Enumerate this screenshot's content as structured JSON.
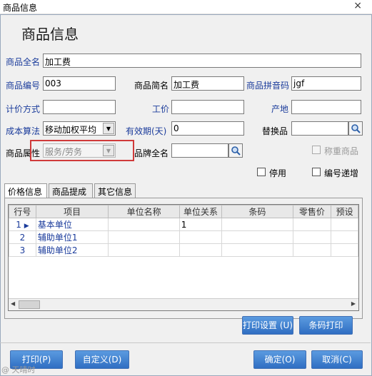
{
  "window": {
    "title": "商品信息",
    "close_glyph": "×"
  },
  "header": {
    "title": "商品信息"
  },
  "form": {
    "full_name": {
      "label": "商品全名",
      "value": "加工费"
    },
    "code": {
      "label": "商品编号",
      "value": "003"
    },
    "short_name": {
      "label": "商品简名",
      "value": "加工费"
    },
    "pinyin": {
      "label": "商品拼音码",
      "value": "jgf"
    },
    "pricing_method": {
      "label": "计价方式",
      "value": ""
    },
    "spec": {
      "label": "工价",
      "value": ""
    },
    "origin": {
      "label": "产地",
      "value": ""
    },
    "cost_method": {
      "label": "成本算法",
      "value": "移动加权平均"
    },
    "validity": {
      "label": "有效期(天)",
      "value": "0"
    },
    "substitute": {
      "label": "替换品",
      "value": ""
    },
    "attribute": {
      "label": "商品属性",
      "value": "服务/劳务"
    },
    "brand": {
      "label": "品牌全名",
      "value": ""
    },
    "weighed": {
      "label": "称重商品"
    },
    "disabled": {
      "label": "停用"
    },
    "code_increment": {
      "label": "编号递增"
    }
  },
  "tabs": [
    "价格信息",
    "商品提成",
    "其它信息"
  ],
  "grid": {
    "columns": [
      "行号",
      "项目",
      "单位名称",
      "单位关系",
      "条码",
      "零售价",
      "预设"
    ],
    "rows": [
      {
        "no": "1",
        "item": "基本单位",
        "unit_name": "",
        "relation": "1",
        "barcode": "",
        "retail": "",
        "preset": ""
      },
      {
        "no": "2",
        "item": "辅助单位1",
        "unit_name": "",
        "relation": "",
        "barcode": "",
        "retail": "",
        "preset": ""
      },
      {
        "no": "3",
        "item": "辅助单位2",
        "unit_name": "",
        "relation": "",
        "barcode": "",
        "retail": "",
        "preset": ""
      }
    ]
  },
  "buttons": {
    "print_settings": "打印设置 (U)",
    "barcode_print": "条码打印",
    "print": "打印(P)",
    "customize": "自定义(D)",
    "ok": "确定(O)",
    "cancel": "取消(C)"
  },
  "watermark": "@ 天晴时"
}
